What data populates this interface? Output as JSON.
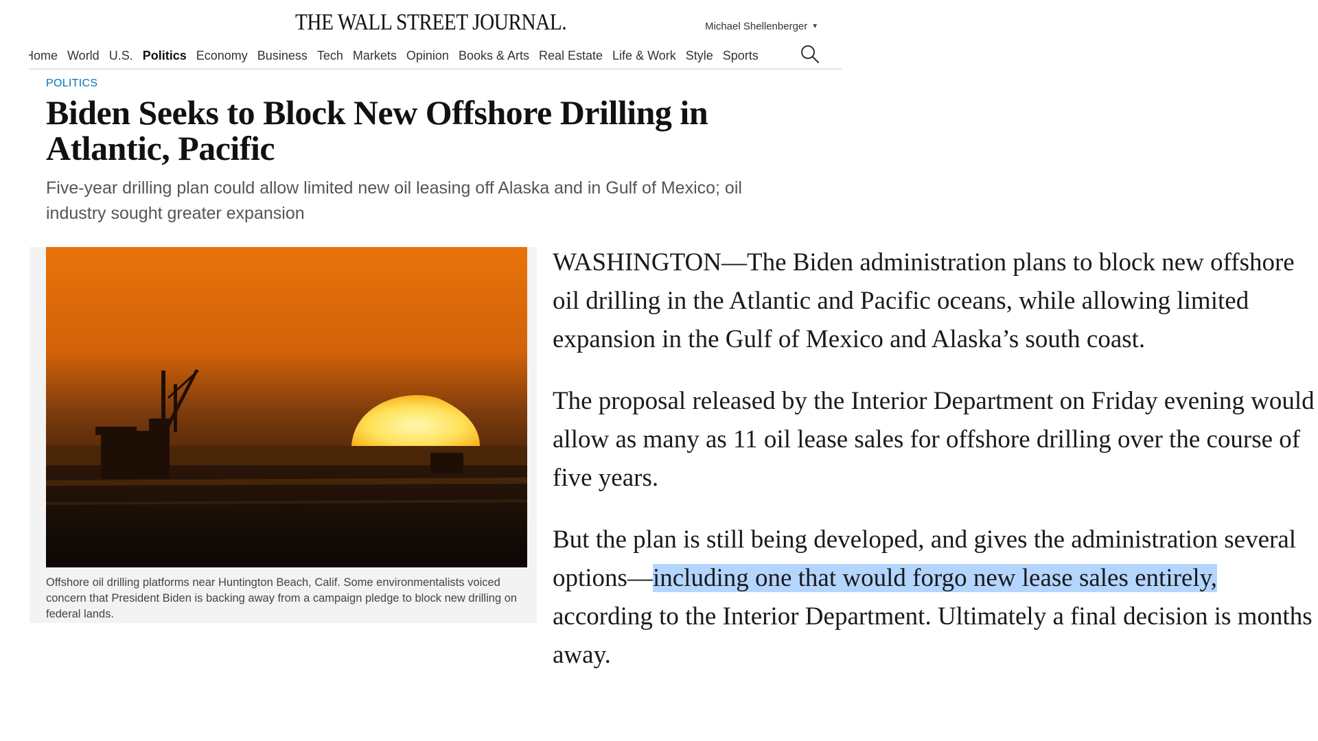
{
  "header": {
    "masthead": "THE WALL STREET JOURNAL.",
    "user_name": "Michael Shellenberger",
    "user_caret": "▼"
  },
  "nav": {
    "items": [
      {
        "label": "Home",
        "active": false
      },
      {
        "label": "World",
        "active": false
      },
      {
        "label": "U.S.",
        "active": false
      },
      {
        "label": "Politics",
        "active": true
      },
      {
        "label": "Economy",
        "active": false
      },
      {
        "label": "Business",
        "active": false
      },
      {
        "label": "Tech",
        "active": false
      },
      {
        "label": "Markets",
        "active": false
      },
      {
        "label": "Opinion",
        "active": false
      },
      {
        "label": "Books & Arts",
        "active": false
      },
      {
        "label": "Real Estate",
        "active": false
      },
      {
        "label": "Life & Work",
        "active": false
      },
      {
        "label": "Style",
        "active": false
      },
      {
        "label": "Sports",
        "active": false
      }
    ],
    "search_icon": "search-icon"
  },
  "article": {
    "section": "POLITICS",
    "headline": "Biden Seeks to Block New Offshore Drilling in Atlantic, Pacific",
    "dek": "Five-year drilling plan could allow limited new oil leasing off Alaska and in Gulf of Mexico; oil industry sought greater expansion",
    "caption": "Offshore oil drilling platforms near Huntington Beach, Calif. Some environmentalists voiced concern that President Biden is backing away from a campaign pledge to block new drilling on federal lands.",
    "paragraphs": [
      {
        "before": "WASHINGTON—The Biden administration plans to block new offshore oil drilling in the Atlantic and Pacific oceans, while allowing limited expansion in the Gulf of Mexico and Alaska’s south coast.",
        "highlight": "",
        "after": ""
      },
      {
        "before": "The proposal released by the Interior Department on Friday evening would allow as many as 11 oil lease sales for offshore drilling over the course of five years.",
        "highlight": "",
        "after": ""
      },
      {
        "before": "But the plan is still being developed, and gives the administration several options—",
        "highlight": "including one that would forgo new lease sales entirely,",
        "after": " according to the Interior Department. Ultimately a final decision is months away."
      }
    ]
  },
  "colors": {
    "section_blue": "#0274b6",
    "selection": "#b4d5fe"
  }
}
